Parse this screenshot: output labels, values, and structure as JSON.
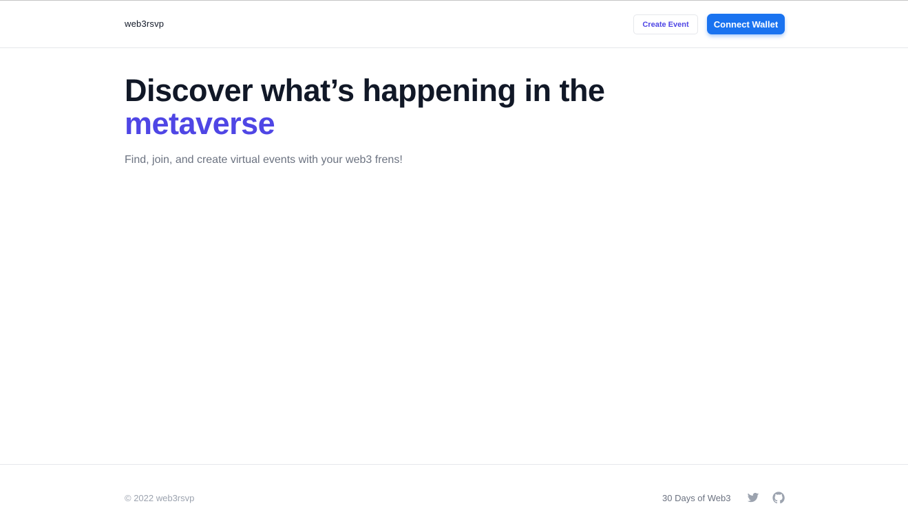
{
  "header": {
    "brand": "web3rsvp",
    "create_event_label": "Create Event",
    "connect_wallet_label": "Connect Wallet"
  },
  "hero": {
    "title_part1": "Discover what’s happening in the ",
    "title_accent": "metaverse",
    "subtitle": "Find, join, and create virtual events with your web3 frens!"
  },
  "footer": {
    "copyright": "© 2022 web3rsvp",
    "link_label": "30 Days of Web3",
    "icons": [
      "twitter-icon",
      "github-icon"
    ]
  },
  "colors": {
    "accent": "#4f46e5",
    "primary_button": "#1a73f0",
    "muted_text": "#6b7280"
  }
}
